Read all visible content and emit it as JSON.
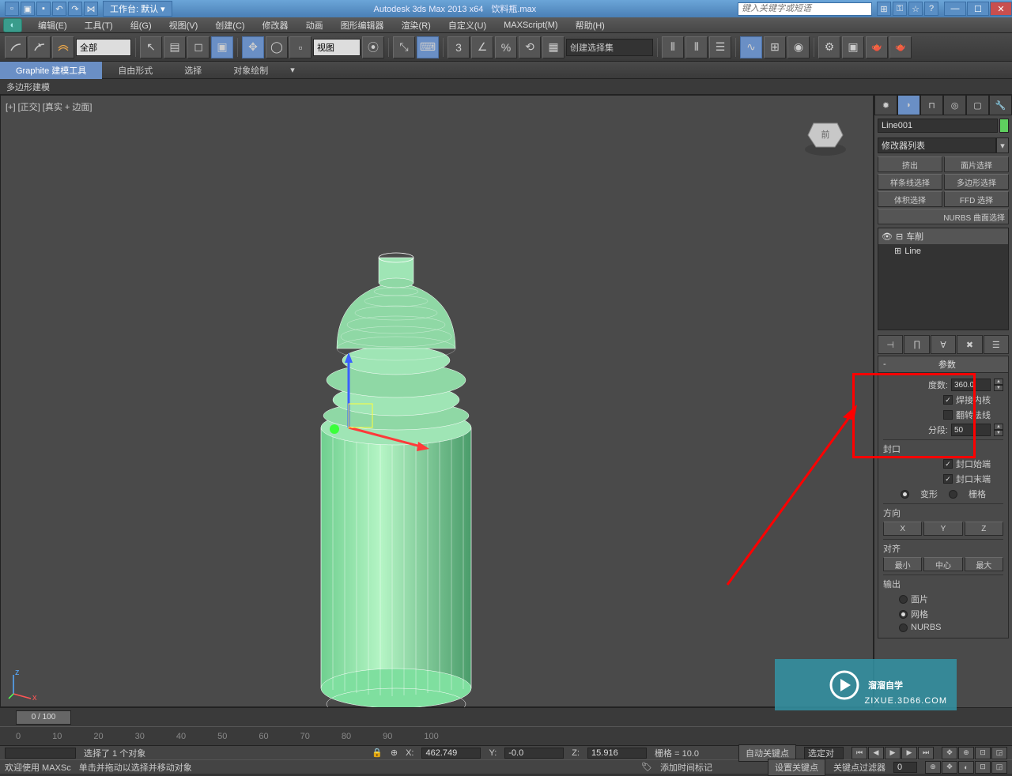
{
  "title": {
    "app": "Autodesk 3ds Max  2013 x64",
    "file": "饮料瓶.max",
    "workspace_label": "工作台: 默认",
    "search_placeholder": "键入关键字或短语"
  },
  "menu": {
    "items": [
      "编辑(E)",
      "工具(T)",
      "组(G)",
      "视图(V)",
      "创建(C)",
      "修改器",
      "动画",
      "图形编辑器",
      "渲染(R)",
      "自定义(U)",
      "MAXScript(M)",
      "帮助(H)"
    ]
  },
  "toolbar": {
    "filter": "全部",
    "refcoord": "视图",
    "namedsel": "创建选择集"
  },
  "ribbon": {
    "tabs": [
      "Graphite 建模工具",
      "自由形式",
      "选择",
      "对象绘制"
    ],
    "sub": "多边形建模"
  },
  "viewport": {
    "label": "[+] [正交] [真实 + 边面]"
  },
  "cmdpanel": {
    "object_name": "Line001",
    "modlist_label": "修改器列表",
    "buttons": [
      "挤出",
      "面片选择",
      "样条线选择",
      "多边形选择",
      "体积选择",
      "FFD 选择",
      "NURBS 曲面选择"
    ],
    "stack": [
      "车削",
      "Line"
    ]
  },
  "params": {
    "rollout_title": "参数",
    "degrees_label": "度数:",
    "degrees_value": "360.0",
    "weld_label": "焊接内核",
    "weld_checked": true,
    "flip_label": "翻转法线",
    "flip_checked": false,
    "segs_label": "分段:",
    "segs_value": "50",
    "cap_group": "封口",
    "cap_start": "封口始端",
    "cap_start_checked": true,
    "cap_end": "封口末端",
    "cap_end_checked": true,
    "morph": "变形",
    "grid": "栅格",
    "dir_group": "方向",
    "dir_x": "X",
    "dir_y": "Y",
    "dir_z": "Z",
    "align_group": "对齐",
    "align_min": "最小",
    "align_center": "中心",
    "align_max": "最大",
    "output_group": "输出",
    "out_patch": "面片",
    "out_mesh": "网格",
    "out_nurbs": "NURBS"
  },
  "timeline": {
    "slider": "0 / 100",
    "ticks": [
      "0",
      "10",
      "20",
      "30",
      "40",
      "50",
      "60",
      "70",
      "80",
      "90",
      "100"
    ]
  },
  "status": {
    "selected": "选择了 1 个对象",
    "hint": "单击并拖动以选择并移动对象",
    "welcome": "欢迎使用 MAXSc",
    "x": "462.749",
    "y": "-0.0",
    "z": "15.916",
    "grid": "栅格 = 10.0",
    "addtime": "添加时间标记",
    "autokey": "自动关键点",
    "setkey": "设置关键点",
    "filters": "关键点过滤器",
    "selected_combo": "选定对"
  },
  "watermark": {
    "text": "溜溜自学",
    "url": "ZIXUE.3D66.COM"
  }
}
